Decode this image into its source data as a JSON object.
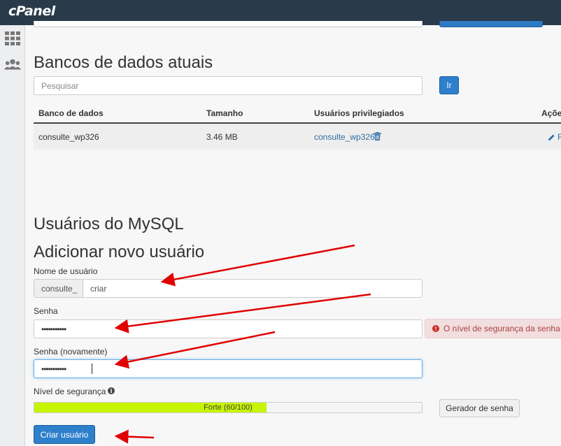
{
  "app": {
    "logo_text": "cPanel"
  },
  "sidebar": {
    "items": [
      {
        "icon": "grid-icon"
      },
      {
        "icon": "users-icon"
      }
    ]
  },
  "current_databases": {
    "title": "Bancos de dados atuais",
    "search_placeholder": "Pesquisar",
    "go_label": "Ir",
    "columns": [
      "Banco de dados",
      "Tamanho",
      "Usuários privilegiados",
      "Ações"
    ],
    "rows": [
      {
        "database": "consulte_wp326",
        "size": "3.46 MB",
        "user": "consulte_wp326",
        "action_partial": "R"
      }
    ]
  },
  "mysql_users": {
    "title": "Usuários do MySQL",
    "subtitle": "Adicionar novo usuário",
    "username_label": "Nome de usuário",
    "username_prefix": "consulte_",
    "username_value": "criar",
    "password_label": "Senha",
    "password_value": "•••••••••••",
    "password_again_label": "Senha (novamente)",
    "password_again_value": "•••••••••••",
    "strength_alert": "O nível de segurança da senha d",
    "strength_label": "Nível de segurança",
    "strength_text": "Forte (60/100)",
    "strength_percent": 60,
    "generator_label": "Gerador de senha",
    "create_label": "Criar usuário"
  },
  "colors": {
    "topbar": "#293a4a",
    "primary": "#2e7fcc",
    "meter_fill": "#c7f400",
    "alert_bg": "#f2dede",
    "arrow": "#e00000"
  }
}
